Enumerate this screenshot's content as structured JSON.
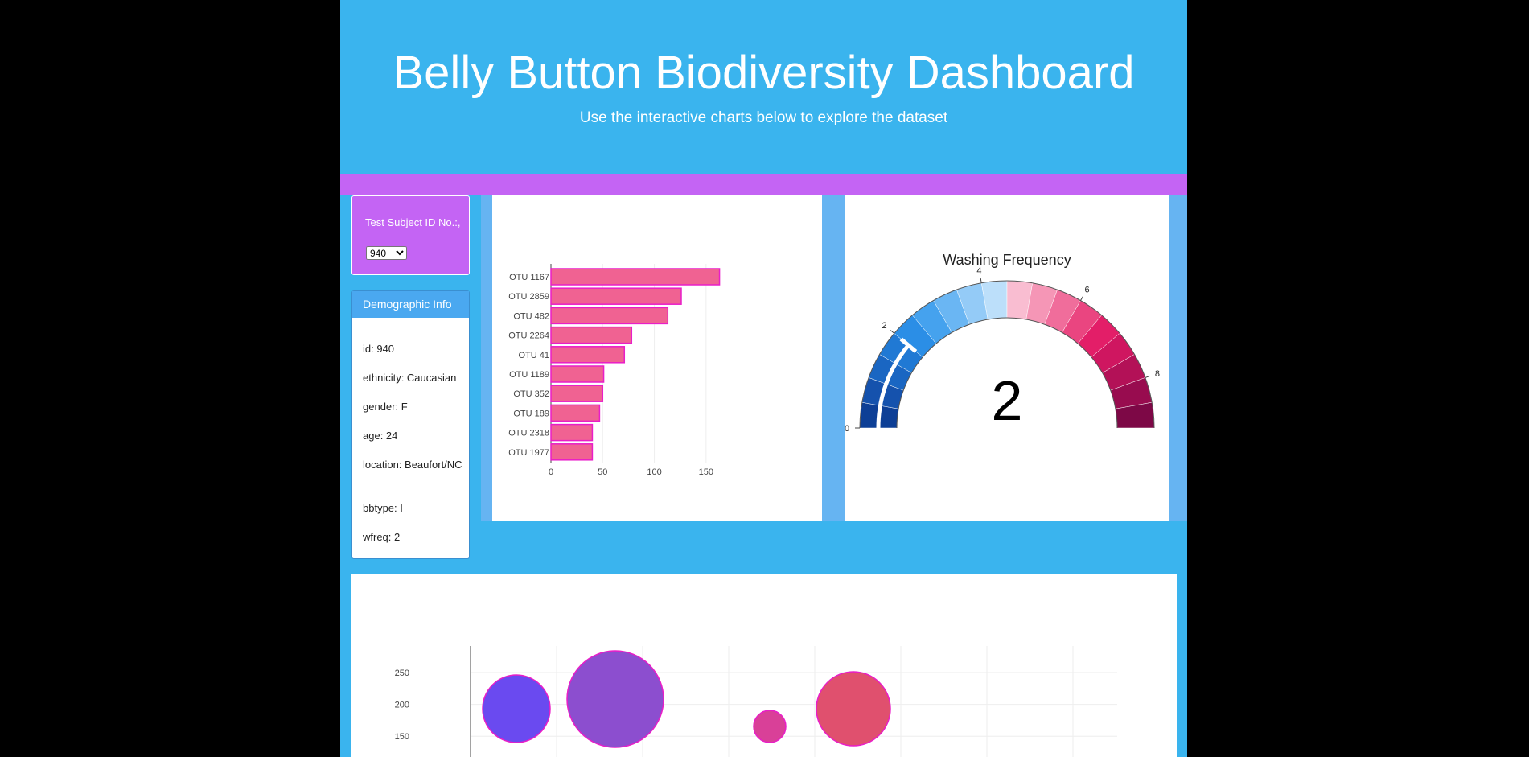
{
  "header": {
    "title": "Belly Button Biodiversity Dashboard",
    "subtitle": "Use the interactive charts below to explore the dataset"
  },
  "selector": {
    "label": "Test Subject ID No.:,",
    "selected": "940"
  },
  "demographics": {
    "heading": "Demographic Info",
    "items": [
      "id: 940",
      "ethnicity: Caucasian",
      "gender: F",
      "age: 24",
      "location: Beaufort/NC",
      "bbtype: I",
      "wfreq: 2"
    ]
  },
  "colors": {
    "background": "#3ab4ee",
    "accent_purple": "#c464f4",
    "bar_fill": "#f06292",
    "bar_outline": "#e91ec8"
  },
  "chart_data": [
    {
      "type": "bar",
      "orientation": "horizontal",
      "categories": [
        "OTU 1167",
        "OTU 2859",
        "OTU 482",
        "OTU 2264",
        "OTU 41",
        "OTU 1189",
        "OTU 352",
        "OTU 189",
        "OTU 2318",
        "OTU 1977"
      ],
      "values": [
        163,
        126,
        113,
        78,
        71,
        51,
        50,
        47,
        40,
        40
      ],
      "xlim": [
        0,
        175
      ],
      "xticks": [
        0,
        50,
        100,
        150
      ]
    },
    {
      "type": "gauge",
      "title": "Washing Frequency",
      "value": 2,
      "range": [
        0,
        9
      ],
      "ticks": [
        0,
        2,
        4,
        6,
        8
      ],
      "step_colors": [
        "#0d3f96",
        "#1552ad",
        "#1a66c2",
        "#2079d4",
        "#2b8ee6",
        "#45a2ee",
        "#6ab6f3",
        "#94cbf7",
        "#bcdffa",
        "#f9bdd1",
        "#f596b6",
        "#f06d9b",
        "#ea4580",
        "#e31e68",
        "#cf1660",
        "#b31157",
        "#980c4f",
        "#7d0846"
      ]
    },
    {
      "type": "scatter",
      "subtype": "bubble",
      "yticks": [
        150,
        200,
        250
      ],
      "points": [
        {
          "cx": 205,
          "cy": 168,
          "r": 42,
          "color": "#6a4af0"
        },
        {
          "cx": 328,
          "cy": 156,
          "r": 60,
          "color": "#8c4ecf"
        },
        {
          "cx": 520,
          "cy": 190,
          "r": 20,
          "color": "#d94098"
        },
        {
          "cx": 624,
          "cy": 168,
          "r": 46,
          "color": "#e0506e"
        }
      ]
    }
  ]
}
